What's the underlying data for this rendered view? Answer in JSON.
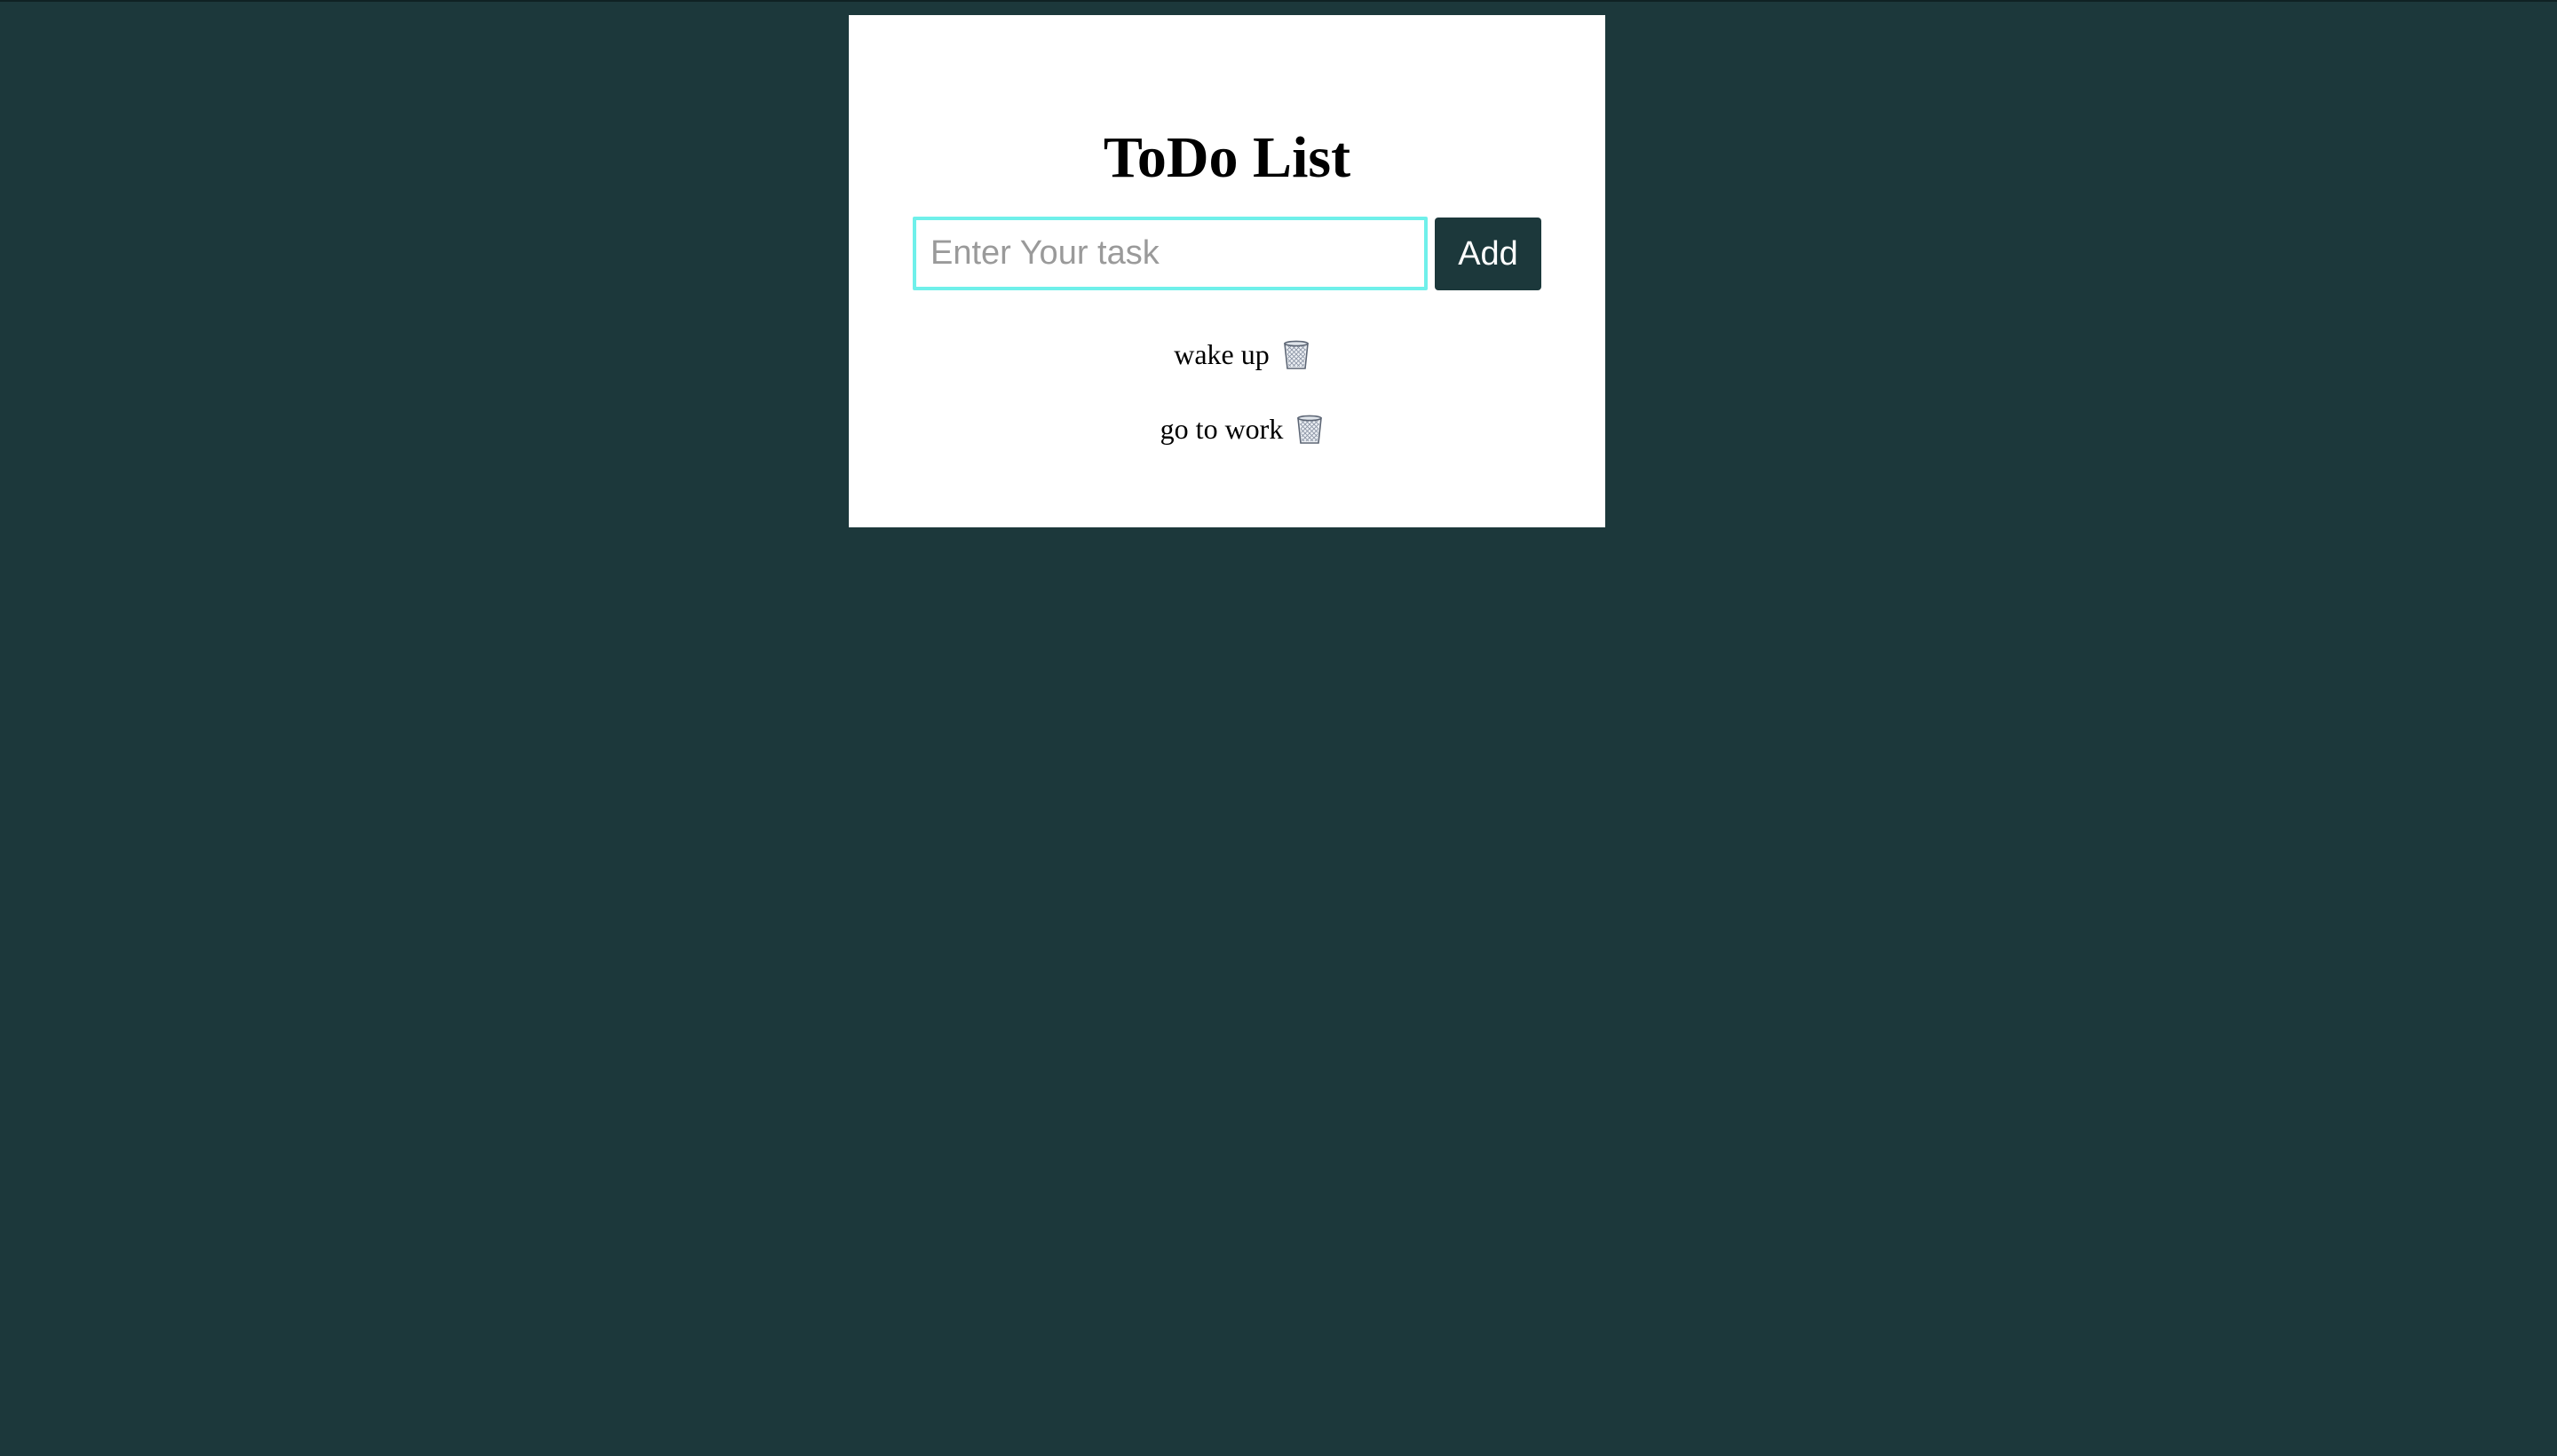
{
  "app": {
    "title": "ToDo List"
  },
  "form": {
    "input_value": "",
    "input_placeholder": "Enter Your task",
    "add_label": "Add"
  },
  "tasks": [
    {
      "text": "wake up",
      "delete_icon": "wastebasket-icon"
    },
    {
      "text": "go to work",
      "delete_icon": "wastebasket-icon"
    }
  ],
  "colors": {
    "page_background": "#1c383b",
    "card_background": "#ffffff",
    "button_background": "#1c383b",
    "input_focus_border": "#6ff0ea"
  }
}
